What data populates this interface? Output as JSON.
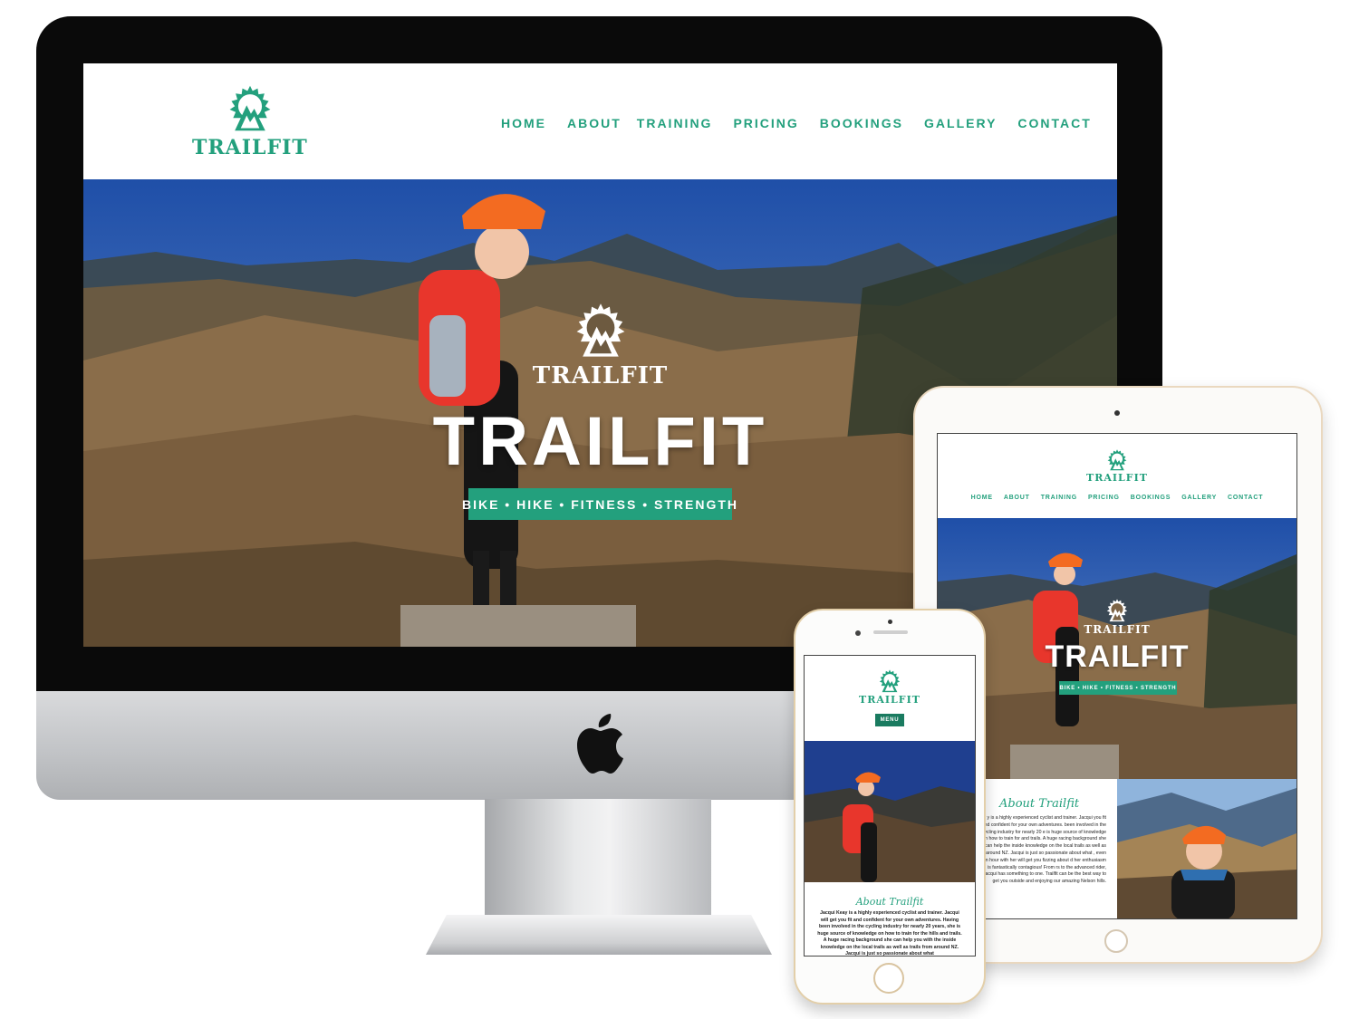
{
  "brand": {
    "name": "TRAILFIT",
    "accent": "#23a07d",
    "accent_dark": "#1a7b60"
  },
  "nav": [
    "HOME",
    "ABOUT",
    "TRAINING",
    "PRICING",
    "BOOKINGS",
    "GALLERY",
    "CONTACT"
  ],
  "hero": {
    "title": "TRAILFIT",
    "tagline": "BIKE • HIKE • FITNESS • STRENGTH"
  },
  "mobile": {
    "menu_label": "MENU"
  },
  "about": {
    "heading": "About Trailfit",
    "tablet_text": "y is a highly experienced cyclist and trainer. Jacqui you fit and confident for your own adventures. been involved in the cycling industry for nearly 20 e is huge source of knowledge on how to train for and trails. A huge racing background she can help the inside knowledge on the local trails as well as around NZ. Jacqui is just so passionate about what , even an hour with her will get you fizzing about d her enthusiasm is fantastically contagious! From rs to the advanced rider, Jacqui has something to one. Trailfit can be the best way to get you outside and enjoying our amazing Nelson hills.",
    "phone_text": "Jacqui Keay is a highly experienced cyclist and trainer. Jacqui will get you fit and confident for your own adventures. Having been involved in the cycling industry for nearly 20 years, she is huge source of knowledge on how to train for the hills and trails. A huge racing background she can help you with the inside knowledge on the local trails as well as trails from around NZ. Jacqui is just so passionate about what"
  },
  "icons": {
    "logo": "gear-mountain-icon",
    "device_brand": "apple-logo-icon"
  }
}
